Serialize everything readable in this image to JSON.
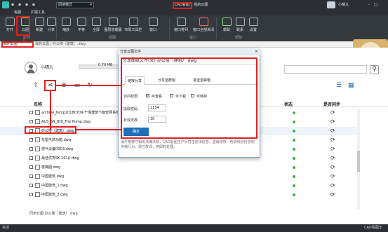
{
  "titlebar": {
    "quick_access": "▪ ▪ ▪ ▪",
    "mode": "阅读模式",
    "title": "CAD看图王 我的云图",
    "username": "小晴儿",
    "window_controls": "– □ ×"
  },
  "ribbon": {
    "tabs": [
      {
        "label": "看图"
      },
      {
        "label": "扩展工具"
      }
    ],
    "buttons": [
      {
        "label": "打开"
      },
      {
        "label": "云图"
      },
      {
        "label": "新建"
      },
      {
        "label": "分享"
      },
      {
        "label": "缩放"
      },
      {
        "label": "平移"
      },
      {
        "label": "全屏"
      },
      {
        "label": "图层管理器"
      },
      {
        "label": "布局工具栏"
      },
      {
        "label": "窗口"
      },
      {
        "label": "窗口排列"
      },
      {
        "label": "窗口全部关闭"
      },
      {
        "label": "帮助"
      },
      {
        "label": "联系"
      },
      {
        "label": "设置"
      }
    ],
    "groups": [
      {
        "label": "文件"
      },
      {
        "label": "视图"
      },
      {
        "label": "窗口"
      },
      {
        "label": "帮助"
      }
    ]
  },
  "breadcrumb": {
    "button": "我的云图",
    "path": "我的云图 / 办公楼（建筑）.dwg"
  },
  "user": {
    "name": "小晴儿",
    "storage": "0.79 MB"
  },
  "search": {
    "placeholder": ""
  },
  "table": {
    "headers": {
      "name": "名称",
      "status": "状态",
      "sync": "是否同步"
    },
    "rows": [
      {
        "name": "archive_temp20180709-干燥建筑下面管网系统_v3.dwg",
        "status_color": "#3bb34a",
        "sync": "⟳"
      },
      {
        "name": "AUS_SN_BOI_Fire Pump.dwg",
        "status_color": "#3bb34a",
        "sync": "⟳"
      },
      {
        "name": "办公楼（建筑）.dwg",
        "status_color": "#3bb34a",
        "sync": "⟳"
      },
      {
        "name": "东塑气前功能.dwg",
        "status_color": "#3bb34a",
        "sync": "⟳"
      },
      {
        "name": "燃气设备RS03.dwg",
        "status_color": "#3bb34a",
        "sync": "⟳"
      },
      {
        "name": "最佳优秀SK.191().dwg",
        "status_color": "#3bb34a",
        "sync": "⟳"
      },
      {
        "name": "楼梯图.dwg",
        "status_color": "#3bb34a",
        "sync": "⟳"
      },
      {
        "name": "中国建筑.dwg",
        "status_color": "#3bb34a",
        "sync": "⟳"
      },
      {
        "name": "中国建筑_1.dwg",
        "status_color": "#3bb34a",
        "sync": "⟳"
      },
      {
        "name": "中国建筑_2.dwg",
        "status_color": "#3bb34a",
        "sync": "⟳"
      }
    ]
  },
  "bottom_crumb": "同步云图 办公楼（建筑）.dwg",
  "statusbar": {
    "left": "完成",
    "right": "CAD看图王"
  },
  "dialog": {
    "title": "分享云图文件",
    "head": "分享图纸文件(夹):办公楼（建筑）.dwg",
    "tabs": [
      {
        "label": "链接分享"
      },
      {
        "label": "分享至群组"
      },
      {
        "label": "发送至邮箱"
      }
    ],
    "perm_label": "访问权限:",
    "perms": [
      {
        "label": "可查看",
        "checked": true
      },
      {
        "label": "可下载",
        "checked": false
      },
      {
        "label": "可转存",
        "checked": false
      }
    ],
    "code_label": "提取密码:",
    "code_value": "1154",
    "days_label": "有效天数:",
    "days_value": "30",
    "ok": "确定",
    "note": "请严格遵守相关法律法规，CAD看图王严厉打击违法信息，盗版侵权、色情低俗信息的传播行为，现已发现，将即时处理。"
  },
  "colors": {
    "accent": "#e02020",
    "primary": "#1f6fb8",
    "status_green": "#3bb34a"
  }
}
